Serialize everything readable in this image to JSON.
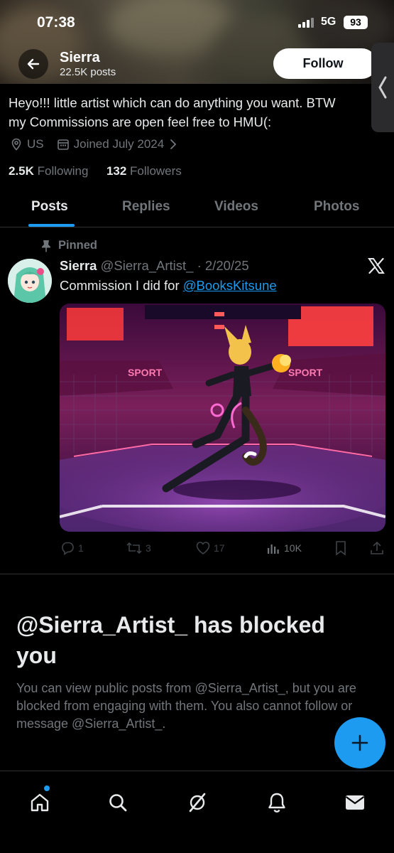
{
  "status_bar": {
    "time": "07:38",
    "network": "5G",
    "battery": "93"
  },
  "header": {
    "name": "Sierra",
    "posts_count": "22.5K posts",
    "follow_label": "Follow"
  },
  "profile": {
    "bio_line1": "Heyo!!! little artist which can do anything you want. BTW",
    "bio_line2": "my Commissions are open feel free to HMU(:",
    "location": "US",
    "joined": "Joined July 2024",
    "following_count": "2.5K",
    "following_label": "Following",
    "followers_count": "132",
    "followers_label": "Followers"
  },
  "tabs": [
    {
      "label": "Posts",
      "active": true
    },
    {
      "label": "Replies",
      "active": false
    },
    {
      "label": "Videos",
      "active": false
    },
    {
      "label": "Photos",
      "active": false
    }
  ],
  "pinned_post": {
    "pinned_label": "Pinned",
    "author_name": "Sierra",
    "handle_date": "@Sierra_Artist_ · 2/20/25",
    "text": "Commission I did for ",
    "mention": "@BooksKitsune",
    "image_signs": [
      "SPORT",
      "SPORT"
    ],
    "replies": "1",
    "reposts": "3",
    "likes": "17",
    "views": "10K"
  },
  "blocked": {
    "title": "@Sierra_Artist_ has blocked you",
    "body": "You can view public posts from @Sierra_Artist_, but you are blocked from engaging with them. You also cannot follow or message @Sierra_Artist_."
  },
  "icons": {
    "back": "arrow-left-icon",
    "side_tab": "chevron-left-icon",
    "location": "map-pin-icon",
    "calendar": "calendar-icon",
    "pin": "pin-icon",
    "x_logo": "x-logo-icon",
    "fab": "plus-icon",
    "nav": [
      "home-icon",
      "search-icon",
      "grok-icon",
      "bell-icon",
      "mail-icon"
    ]
  },
  "colors": {
    "accent": "#1d9bf0",
    "background": "#000000",
    "secondary_text": "#71767b"
  }
}
